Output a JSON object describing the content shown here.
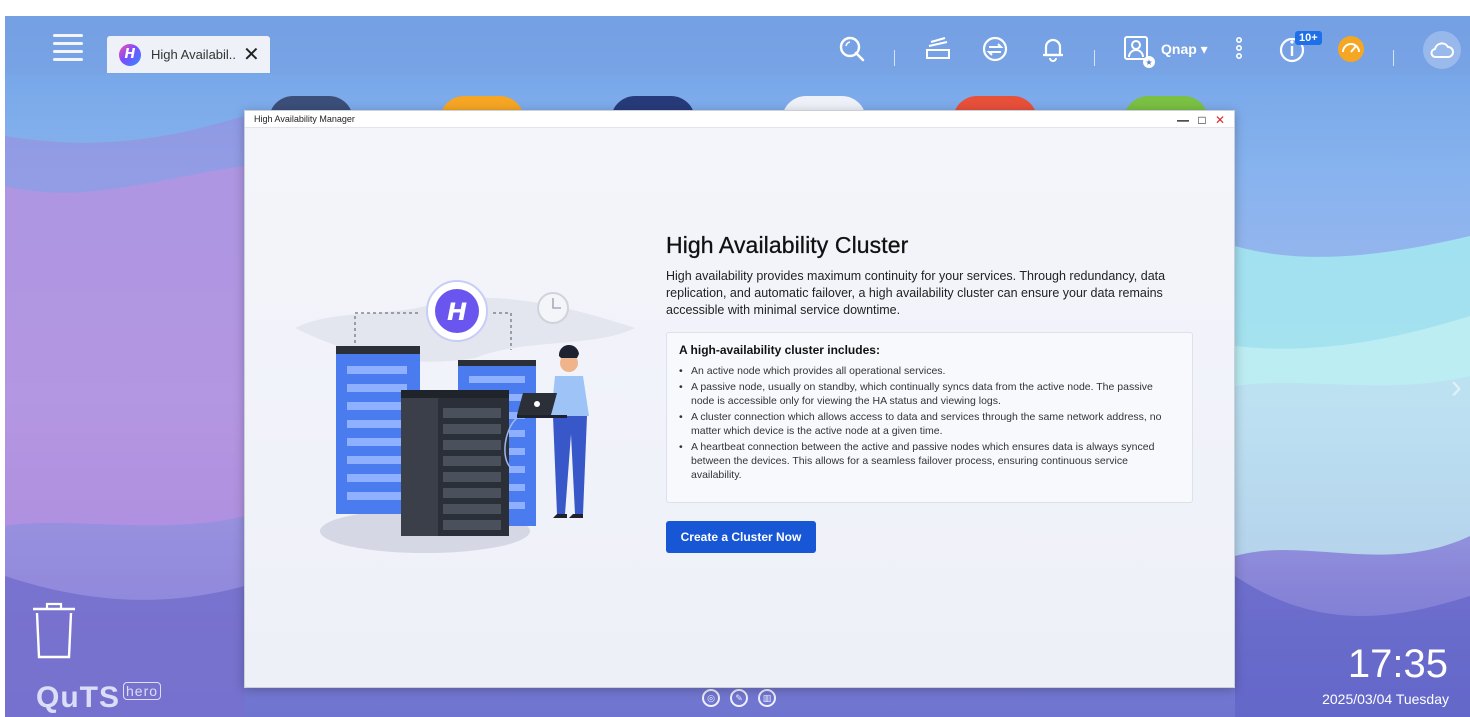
{
  "taskbar": {
    "tab_label": "High Availabil...",
    "tab_close": "✕",
    "user_name": "Qnap ▾",
    "notification_badge": "10+"
  },
  "window": {
    "title": "High Availability Manager",
    "minimize": "—",
    "maximize": "□",
    "close": "✕"
  },
  "main": {
    "heading": "High Availability Cluster",
    "intro": "High availability provides maximum continuity for your services. Through redundancy, data replication, and automatic failover, a high availability cluster can ensure your data remains accessible with minimal service downtime.",
    "box_title": "A high-availability cluster includes:",
    "items": [
      "An active node which provides all operational services.",
      "A passive node, usually on standby, which continually syncs data from the active node. The passive node is accessible only for viewing the HA status and viewing logs.",
      "A cluster connection which allows access to data and services through the same network address, no matter which device is the active node at a given time.",
      "A heartbeat connection between the active and passive nodes which ensures data is always synced between the devices. This allows for a seamless failover process, ensuring continuous service availability."
    ],
    "cta_label": "Create a Cluster Now"
  },
  "desktop": {
    "brand": "QuTS",
    "brand_suffix": "hero",
    "clock": "17:35",
    "date": "2025/03/04 Tuesday"
  },
  "colors": {
    "accent": "#1756d4",
    "badge": "#1e6fe8",
    "server_blue": "#4a7cf0",
    "server_dark": "#2b2f38"
  }
}
